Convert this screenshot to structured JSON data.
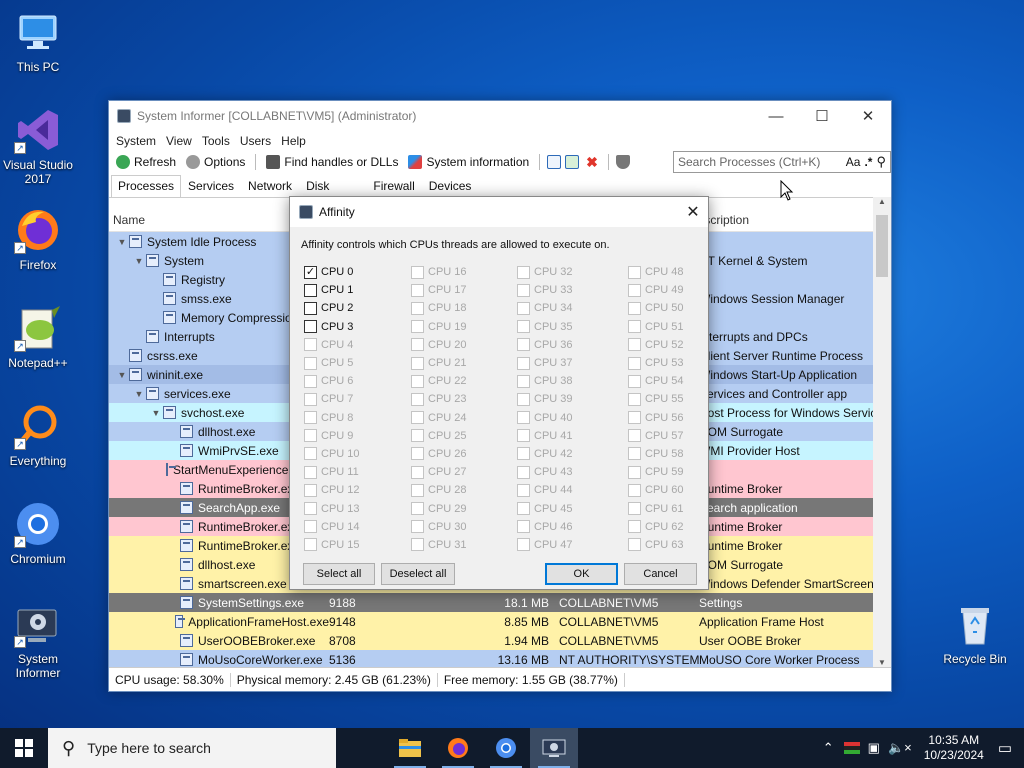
{
  "desktop": {
    "icons": [
      {
        "label": "This PC",
        "icon": "computer-icon"
      },
      {
        "label": "Visual Studio 2017",
        "icon": "visual-studio-icon"
      },
      {
        "label": "Firefox",
        "icon": "firefox-icon"
      },
      {
        "label": "Notepad++",
        "icon": "notepad-plus-plus-icon"
      },
      {
        "label": "Everything",
        "icon": "everything-search-icon"
      },
      {
        "label": "Chromium",
        "icon": "chromium-icon"
      },
      {
        "label": "System Informer",
        "icon": "system-informer-icon"
      },
      {
        "label": "Recycle Bin",
        "icon": "recycle-bin-icon"
      }
    ]
  },
  "window": {
    "title": "System Informer [COLLABNET\\VM5] (Administrator)",
    "menu": [
      "System",
      "View",
      "Tools",
      "Users",
      "Help"
    ],
    "toolbar": {
      "refresh": "Refresh",
      "options": "Options",
      "find": "Find handles or DLLs",
      "sysinfo": "System information"
    },
    "search_placeholder": "Search Processes (Ctrl+K)",
    "search_case": "Aa",
    "search_regex": ".*",
    "tabs": [
      "Processes",
      "Services",
      "Network",
      "Disk",
      "Firewall",
      "Devices"
    ],
    "columns": {
      "name": "Name",
      "description": "Description"
    },
    "processes": [
      {
        "name": "System Idle Process",
        "indent": 0,
        "twisty": "▼",
        "pid": "",
        "mem": "",
        "user": "",
        "desc": "",
        "bg": "#b5cdf2"
      },
      {
        "name": "System",
        "indent": 1,
        "twisty": "▼",
        "pid": "",
        "mem": "",
        "user": "",
        "desc": "NT Kernel & System",
        "bg": "#b5cdf2"
      },
      {
        "name": "Registry",
        "indent": 2,
        "twisty": "",
        "pid": "",
        "mem": "",
        "user": "",
        "desc": "",
        "bg": "#b5cdf2"
      },
      {
        "name": "smss.exe",
        "indent": 2,
        "twisty": "",
        "pid": "",
        "mem": "",
        "user": "",
        "desc": "Windows Session Manager",
        "bg": "#b5cdf2"
      },
      {
        "name": "Memory Compression",
        "indent": 2,
        "twisty": "",
        "pid": "",
        "mem": "",
        "user": "",
        "desc": "",
        "bg": "#b5cdf2"
      },
      {
        "name": "Interrupts",
        "indent": 1,
        "twisty": "",
        "pid": "",
        "mem": "",
        "user": "",
        "desc": "Interrupts and DPCs",
        "bg": "#b5cdf2"
      },
      {
        "name": "csrss.exe",
        "indent": 0,
        "twisty": "",
        "pid": "",
        "mem": "",
        "user": "",
        "desc": "Client Server Runtime Process",
        "bg": "#b5cdf2"
      },
      {
        "name": "wininit.exe",
        "indent": 0,
        "twisty": "▼",
        "pid": "",
        "mem": "",
        "user": "",
        "desc": "Windows Start-Up Application",
        "bg": "#a3bce6"
      },
      {
        "name": "services.exe",
        "indent": 1,
        "twisty": "▼",
        "pid": "",
        "mem": "",
        "user": "",
        "desc": "Services and Controller app",
        "bg": "#b5cdf2"
      },
      {
        "name": "svchost.exe",
        "indent": 2,
        "twisty": "▼",
        "pid": "",
        "mem": "",
        "user": "",
        "desc": "Host Process for Windows Services",
        "bg": "#c6f4ff"
      },
      {
        "name": "dllhost.exe",
        "indent": 3,
        "twisty": "",
        "pid": "",
        "mem": "",
        "user": "",
        "desc": "COM Surrogate",
        "bg": "#b5cdf2"
      },
      {
        "name": "WmiPrvSE.exe",
        "indent": 3,
        "twisty": "",
        "pid": "",
        "mem": "",
        "user": "",
        "desc": "WMI Provider Host",
        "bg": "#c6f4ff"
      },
      {
        "name": "StartMenuExperienceHost.exe",
        "indent": 3,
        "twisty": "",
        "pid": "",
        "mem": "",
        "user": "",
        "desc": "",
        "bg": "#ffc6d0"
      },
      {
        "name": "RuntimeBroker.exe",
        "indent": 3,
        "twisty": "",
        "pid": "",
        "mem": "",
        "user": "",
        "desc": "Runtime Broker",
        "bg": "#ffc6d0"
      },
      {
        "name": "SearchApp.exe",
        "indent": 3,
        "twisty": "",
        "pid": "",
        "mem": "",
        "user": "",
        "desc": "Search application",
        "bg": "#777777"
      },
      {
        "name": "RuntimeBroker.exe",
        "indent": 3,
        "twisty": "",
        "pid": "",
        "mem": "",
        "user": "",
        "desc": "Runtime Broker",
        "bg": "#ffc6d0"
      },
      {
        "name": "RuntimeBroker.exe",
        "indent": 3,
        "twisty": "",
        "pid": "",
        "mem": "",
        "user": "",
        "desc": "Runtime Broker",
        "bg": "#fff2a8"
      },
      {
        "name": "dllhost.exe",
        "indent": 3,
        "twisty": "",
        "pid": "",
        "mem": "",
        "user": "",
        "desc": "COM Surrogate",
        "bg": "#fff2a8"
      },
      {
        "name": "smartscreen.exe",
        "indent": 3,
        "twisty": "",
        "pid": "",
        "mem": "",
        "user": "",
        "desc": "Windows Defender SmartScreen",
        "bg": "#fff2a8"
      },
      {
        "name": "SystemSettings.exe",
        "indent": 3,
        "twisty": "",
        "pid": "9188",
        "mem": "18.1 MB",
        "user": "COLLABNET\\VM5",
        "desc": "Settings",
        "bg": "#777777"
      },
      {
        "name": "ApplicationFrameHost.exe",
        "indent": 3,
        "twisty": "",
        "pid": "9148",
        "mem": "8.85 MB",
        "user": "COLLABNET\\VM5",
        "desc": "Application Frame Host",
        "bg": "#fff2a8"
      },
      {
        "name": "UserOOBEBroker.exe",
        "indent": 3,
        "twisty": "",
        "pid": "8708",
        "mem": "1.94 MB",
        "user": "COLLABNET\\VM5",
        "desc": "User OOBE Broker",
        "bg": "#fff2a8"
      },
      {
        "name": "MoUsoCoreWorker.exe",
        "indent": 3,
        "twisty": "",
        "pid": "5136",
        "mem": "13.16 MB",
        "user": "NT AUTHORITY\\SYSTEM",
        "desc": "MoUSO Core Worker Process",
        "bg": "#b5cdf2"
      }
    ],
    "status": {
      "cpu": "CPU usage: 58.30%",
      "physical": "Physical memory: 2.45 GB (61.23%)",
      "free": "Free memory: 1.55 GB (38.77%)"
    }
  },
  "dialog": {
    "title": "Affinity",
    "description": "Affinity controls which CPUs threads are allowed to execute on.",
    "cpus": [
      {
        "label": "CPU 0",
        "checked": true,
        "enabled": true
      },
      {
        "label": "CPU 1",
        "checked": false,
        "enabled": true
      },
      {
        "label": "CPU 2",
        "checked": false,
        "enabled": true
      },
      {
        "label": "CPU 3",
        "checked": false,
        "enabled": true
      }
    ],
    "disabled_label_prefix": "CPU ",
    "cpu_count": 64,
    "buttons": {
      "select_all": "Select all",
      "deselect_all": "Deselect all",
      "ok": "OK",
      "cancel": "Cancel"
    }
  },
  "taskbar": {
    "search_placeholder": "Type here to search",
    "apps": [
      "file-explorer-icon",
      "firefox-icon",
      "chromium-icon",
      "system-informer-icon"
    ],
    "time": "10:35 AM",
    "date": "10/23/2024"
  }
}
